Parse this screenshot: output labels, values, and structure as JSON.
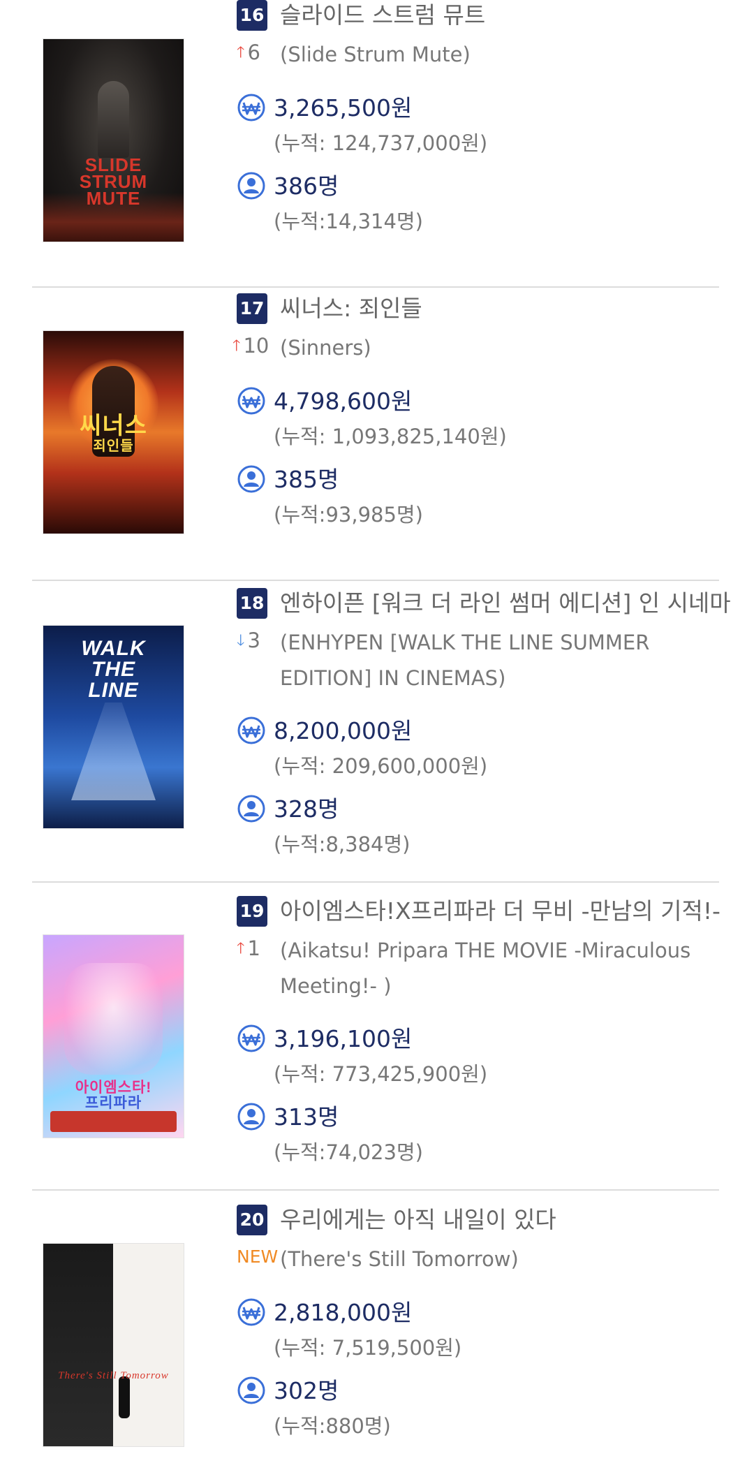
{
  "theme": {
    "rank_bg": "#1d2c64",
    "value_color": "#1d2c64",
    "up_color": "#e8463c",
    "down_color": "#4d8de0",
    "new_color": "#f08a24",
    "icon_color": "#3a6fd8"
  },
  "movies": [
    {
      "rank": "16",
      "change_dir": "up",
      "change": "6",
      "title_ko": "슬라이드 스트럼 뮤트",
      "title_en": "(Slide Strum Mute)",
      "sales": "3,265,500원",
      "sales_cum": "(누적: 124,737,000원)",
      "audience": "386명",
      "audience_cum": "(누적:14,314명)",
      "poster_icon": "poster-slide-strum-mute"
    },
    {
      "rank": "17",
      "change_dir": "up",
      "change": "10",
      "title_ko": "씨너스: 죄인들",
      "title_en": "(Sinners)",
      "sales": "4,798,600원",
      "sales_cum": "(누적: 1,093,825,140원)",
      "audience": "385명",
      "audience_cum": "(누적:93,985명)",
      "poster_icon": "poster-sinners"
    },
    {
      "rank": "18",
      "change_dir": "down",
      "change": "3",
      "title_ko": "엔하이픈 [워크 더 라인 썸머 에디션] 인 시네마",
      "title_en": "(ENHYPEN [WALK THE LINE SUMMER EDITION] IN CINEMAS)",
      "sales": "8,200,000원",
      "sales_cum": "(누적: 209,600,000원)",
      "audience": "328명",
      "audience_cum": "(누적:8,384명)",
      "poster_icon": "poster-walk-the-line"
    },
    {
      "rank": "19",
      "change_dir": "up",
      "change": "1",
      "title_ko": "아이엠스타!X프리파라 더 무비 -만남의 기적!-",
      "title_en": "(Aikatsu! Pripara THE MOVIE -Miraculous Meeting!- )",
      "sales": "3,196,100원",
      "sales_cum": "(누적: 773,425,900원)",
      "audience": "313명",
      "audience_cum": "(누적:74,023명)",
      "poster_icon": "poster-aikatsu-pripara"
    },
    {
      "rank": "20",
      "change_dir": "new",
      "change": "NEW",
      "title_ko": "우리에게는 아직 내일이 있다",
      "title_en": "(There's Still Tomorrow)",
      "sales": "2,818,000원",
      "sales_cum": "(누적: 7,519,500원)",
      "audience": "302명",
      "audience_cum": "(누적:880명)",
      "poster_icon": "poster-theres-still-tomorrow"
    }
  ],
  "poster_text": {
    "p0": [
      "SLIDE",
      "STRUM",
      "MUTE"
    ],
    "p1": [
      "씨너스",
      "죄인들"
    ],
    "p2": [
      "WALK",
      "THE",
      "LINE"
    ],
    "p3": [
      "아이엠스타!",
      "프리파라"
    ],
    "p4": [
      "There's Still Tomorrow"
    ]
  }
}
